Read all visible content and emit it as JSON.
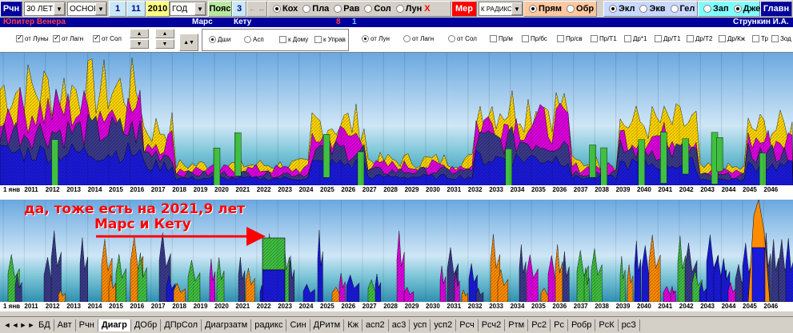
{
  "toolbar": {
    "rch": "Рчн",
    "period_select": "30 ЛЕТ",
    "mode_select": "ОСНОВН",
    "num1": "1",
    "num2": "11",
    "year": "2010",
    "unit_select": "ГОД",
    "poyas": "Пояс",
    "num3": "3",
    "arrows": "← ↔",
    "radios_left": [
      {
        "label": "Кох",
        "on": true
      },
      {
        "label": "Пла",
        "on": false
      },
      {
        "label": "Рав",
        "on": false
      },
      {
        "label": "Сол",
        "on": false
      },
      {
        "label": "Лун",
        "on": false
      }
    ],
    "mer_x": "X",
    "mer_label": "Мер",
    "radix_select": "К РАДИКС",
    "radios_mid": [
      {
        "label": "Прям",
        "on": true
      },
      {
        "label": "Обр",
        "on": false
      }
    ],
    "radios_right": [
      {
        "label": "Экл",
        "on": true
      },
      {
        "label": "Экв",
        "on": false
      },
      {
        "label": "Гел",
        "on": false
      }
    ],
    "radios_far": [
      {
        "label": "Зап",
        "on": false
      },
      {
        "label": "Джет",
        "on": true
      }
    ],
    "glav": "Главн"
  },
  "row2": {
    "planets_left": "Юпитер Венера",
    "mars": "Марс",
    "ketu": "Кету",
    "num8": "8",
    "num1": "1",
    "author": "Стрункин И.А."
  },
  "checkboxes_left": [
    {
      "label": "от Луны",
      "on": true
    },
    {
      "label": "от Лагн",
      "on": true
    },
    {
      "label": "от Сол",
      "on": true
    }
  ],
  "radios_box": [
    {
      "label": "Дши",
      "on": true
    },
    {
      "label": "Асп",
      "on": false
    }
  ],
  "checkboxes_box": [
    {
      "label": "к Дому",
      "on": false
    },
    {
      "label": "к Управ",
      "on": false
    }
  ],
  "radios_right": [
    {
      "label": "от Лун",
      "on": true
    },
    {
      "label": "от Лагн",
      "on": false
    },
    {
      "label": "от Сол",
      "on": false
    }
  ],
  "checkboxes_right": [
    {
      "label": "Пр/м",
      "on": false
    },
    {
      "label": "Пр/бс",
      "on": false
    },
    {
      "label": "Пр/св",
      "on": false
    },
    {
      "label": "Пр/Т1",
      "on": false
    },
    {
      "label": "Др*1",
      "on": false
    },
    {
      "label": "Др/Т1",
      "on": false
    },
    {
      "label": "Др/Т2",
      "on": false
    },
    {
      "label": "Др/Кж",
      "on": false
    },
    {
      "label": "Тр",
      "on": false
    },
    {
      "label": "Зод",
      "on": false
    }
  ],
  "axis_labels": [
    "1 янв",
    "2011",
    "2012",
    "2013",
    "2014",
    "2015",
    "2016",
    "2017",
    "2018",
    "2019",
    "2020",
    "2021",
    "2022",
    "2023",
    "2024",
    "2025",
    "2026",
    "2027",
    "2028",
    "2029",
    "2030",
    "2031",
    "2032",
    "2033",
    "2034",
    "2035",
    "2036",
    "2037",
    "2038",
    "2039",
    "2040",
    "2041",
    "2042",
    "2043",
    "2044",
    "2045",
    "2046"
  ],
  "annotation": {
    "line1": "да, тоже есть на 2021,9 лет",
    "line2": "Марс и Кету"
  },
  "tabs": [
    "БД",
    "Авт",
    "Рчн",
    "Диагр",
    "ДОбр",
    "ДПрСол",
    "Диагрзатм",
    "радикс",
    "Син",
    "ДРитм",
    "Кж",
    "асп2",
    "ас3",
    "усп",
    "усп2",
    "Рсч",
    "Рсч2",
    "Ртм",
    "Рс2",
    "Рс",
    "Робр",
    "РсК",
    "рсЗ"
  ],
  "active_tab": "Диагр",
  "colors": {
    "navy": "#00009c",
    "blue": "#1a1adc",
    "darkslate": "#3a3a8c",
    "yellow": "#ffd700",
    "magenta": "#e000e0",
    "orange": "#ff8c00",
    "green": "#40c040",
    "red": "#ff0000"
  }
}
